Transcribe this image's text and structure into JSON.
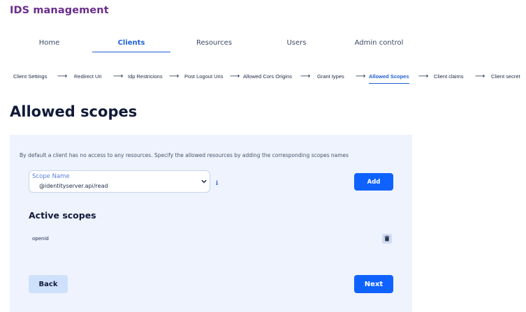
{
  "app": {
    "title": "IDS management"
  },
  "nav": {
    "tabs": [
      {
        "label": "Home"
      },
      {
        "label": "Clients"
      },
      {
        "label": "Resources"
      },
      {
        "label": "Users"
      },
      {
        "label": "Admin control"
      }
    ],
    "active": "Clients"
  },
  "steps": {
    "items": [
      {
        "label": "Client Settings"
      },
      {
        "label": "Redirect Uri"
      },
      {
        "label": "Idp Restricions"
      },
      {
        "label": "Post Logout Uris"
      },
      {
        "label": "Allowed Cors Origins"
      },
      {
        "label": "Grant types"
      },
      {
        "label": "Allowed Scopes"
      },
      {
        "label": "Client claims"
      },
      {
        "label": "Client secret"
      }
    ],
    "active": "Allowed Scopes"
  },
  "page": {
    "title": "Allowed scopes",
    "description": "By default a client has no access to any resources. Specify the allowed resources by adding the corresponding scopes names"
  },
  "scope_select": {
    "label": "Scope Name",
    "value": "@identityserver.api/read"
  },
  "buttons": {
    "add": "Add",
    "back": "Back",
    "next": "Next"
  },
  "active_scopes": {
    "title": "Active scopes",
    "items": [
      {
        "name": "openid"
      }
    ]
  },
  "icons": {
    "info": "info-icon",
    "delete": "trash-icon",
    "dropdown": "chevron-down-icon",
    "step_separator": "arrow-right-icon"
  },
  "colors": {
    "brand": "#6a2e8d",
    "accent": "#1f5fd4",
    "primary_button": "#0f62fe",
    "secondary_button": "#cfe0fb",
    "panel_background": "#eef3fd"
  }
}
